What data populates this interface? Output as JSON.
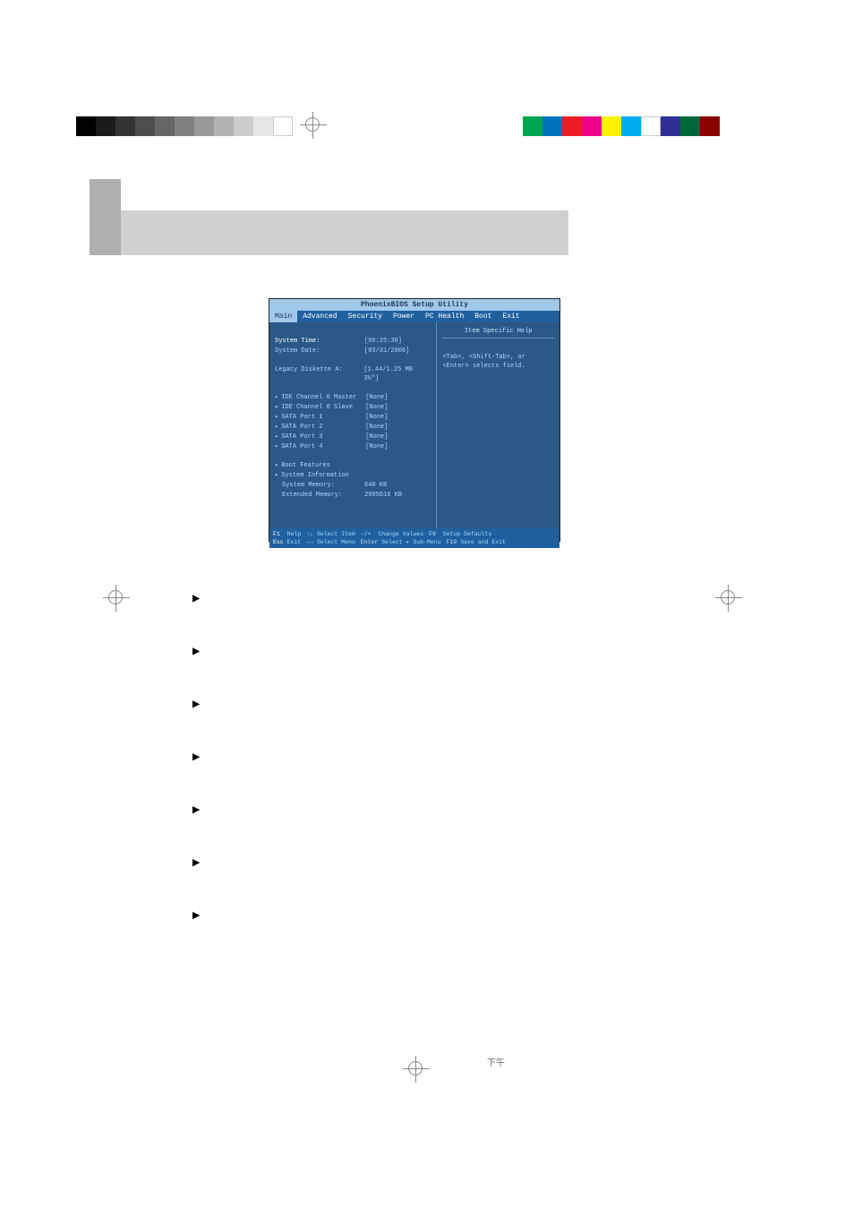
{
  "bios": {
    "title": "PhoenixBIOS Setup Utility",
    "tabs": [
      "Main",
      "Advanced",
      "Security",
      "Power",
      "PC Health",
      "Boot",
      "Exit"
    ],
    "active_tab": "Main",
    "fields": {
      "system_time": {
        "label": "System Time:",
        "value": "[09:25:36]"
      },
      "system_date": {
        "label": "System Date:",
        "value": "[03/31/2006]"
      },
      "legacy_diskette": {
        "label": "Legacy Diskette A:",
        "value": "[1.44/1.25 MB  3½\"]"
      },
      "ide_master": {
        "label": "IDE Channel 0 Master",
        "value": "[None]"
      },
      "ide_slave": {
        "label": "IDE Channel 0 Slave",
        "value": "[None]"
      },
      "sata1": {
        "label": "SATA Port 1",
        "value": "[None]"
      },
      "sata2": {
        "label": "SATA Port 2",
        "value": "[None]"
      },
      "sata3": {
        "label": "SATA Port 3",
        "value": "[None]"
      },
      "sata4": {
        "label": "SATA Port 4",
        "value": "[None]"
      },
      "boot_features": {
        "label": "Boot Features"
      },
      "system_info": {
        "label": "System Information"
      },
      "system_memory": {
        "label": "System Memory:",
        "value": "640 KB"
      },
      "extended_memory": {
        "label": "Extended Memory:",
        "value": "2095616 KB"
      }
    },
    "help": {
      "title": "Item Specific Help",
      "text1": "<Tab>, <Shift-Tab>, or",
      "text2": "<Enter> selects field."
    },
    "footer": {
      "f1": "F1",
      "help": "Help",
      "updown": "↑↓",
      "select_item": "Select Item",
      "pm": "-/+",
      "change_values": "Change Values",
      "f9": "F9",
      "setup_defaults": "Setup Defaults",
      "esc": "Esc",
      "exit": "Exit",
      "lr": "←→",
      "select_menu": "Select Menu",
      "enter": "Enter",
      "select_submenu": "Select ▸ Sub-Menu",
      "f10": "F10",
      "save_exit": "Save and Exit"
    }
  },
  "doc": {
    "timestamp": "下午"
  },
  "colors": {
    "grays": [
      "#000000",
      "#1a1a1a",
      "#333333",
      "#4d4d4d",
      "#666666",
      "#808080",
      "#999999",
      "#b3b3b3",
      "#cccccc",
      "#e6e6e6",
      "#ffffff"
    ],
    "cmyk": [
      "#00a651",
      "#0072bc",
      "#ed1c24",
      "#ec008c",
      "#fff200",
      "#00aeef",
      "#ffffff",
      "#2e3192",
      "#006838",
      "#8b0000"
    ]
  }
}
